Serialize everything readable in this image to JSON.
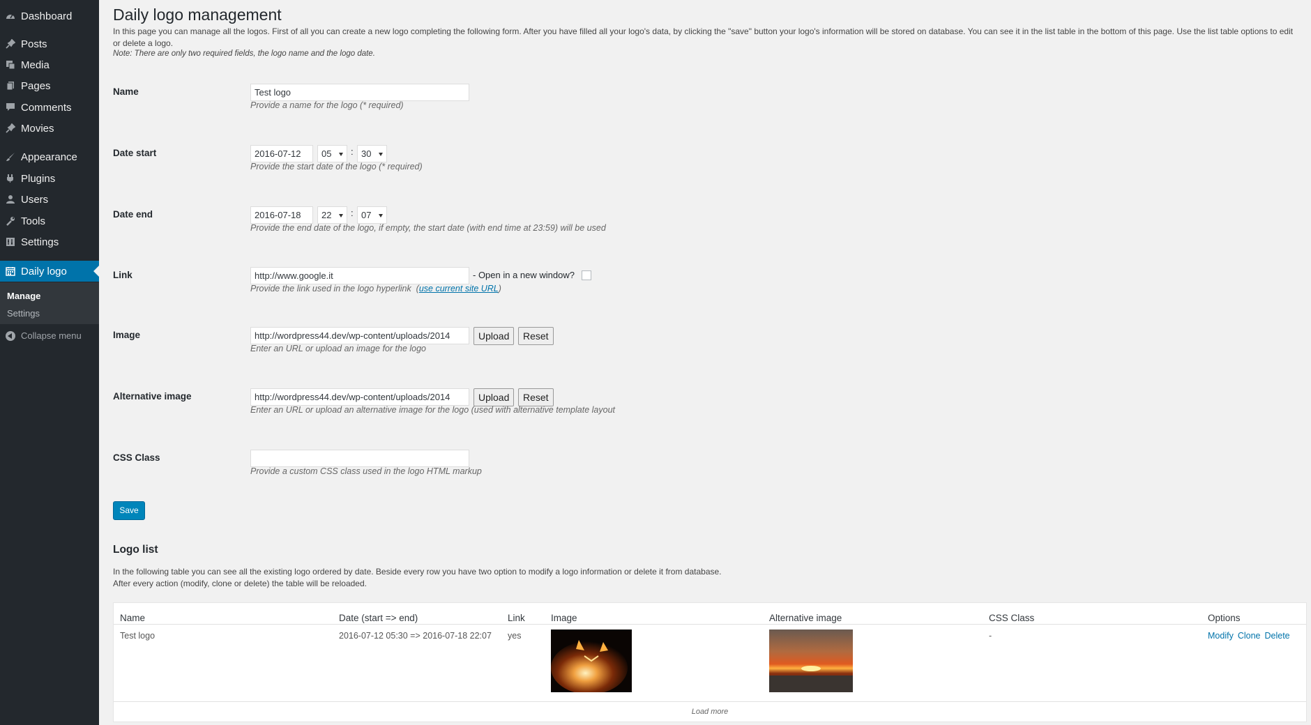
{
  "sidebar": {
    "items": [
      {
        "label": "Dashboard",
        "icon": "dashboard-icon"
      },
      {
        "label": "Posts",
        "icon": "pin-icon"
      },
      {
        "label": "Media",
        "icon": "media-icon"
      },
      {
        "label": "Pages",
        "icon": "pages-icon"
      },
      {
        "label": "Comments",
        "icon": "comments-icon"
      },
      {
        "label": "Movies",
        "icon": "pin-icon"
      },
      {
        "label": "Appearance",
        "icon": "brush-icon"
      },
      {
        "label": "Plugins",
        "icon": "plugin-icon"
      },
      {
        "label": "Users",
        "icon": "users-icon"
      },
      {
        "label": "Tools",
        "icon": "wrench-icon"
      },
      {
        "label": "Settings",
        "icon": "settings-icon"
      },
      {
        "label": "Daily logo",
        "icon": "calendar-icon"
      }
    ],
    "submenu": [
      "Manage",
      "Settings"
    ],
    "collapse_label": "Collapse menu"
  },
  "page": {
    "title": "Daily logo management",
    "intro": "In this page you can manage all the logos. First of all you can create a new logo completing the following form. After you have filled all your logo's data, by clicking the \"save\" button your logo's information will be stored on database. You can see it in the list table in the bottom of this page. Use the list table options to edit or delete a logo.",
    "note": "Note: There are only two required fields, the logo name and the logo date."
  },
  "form": {
    "name": {
      "label": "Name",
      "value": "Test logo",
      "desc": "Provide a name for the logo (* required)"
    },
    "date_start": {
      "label": "Date start",
      "date": "2016-07-12",
      "hour": "05",
      "minute": "30",
      "desc": "Provide the start date of the logo (* required)"
    },
    "date_end": {
      "label": "Date end",
      "date": "2016-07-18",
      "hour": "22",
      "minute": "07",
      "desc": "Provide the end date of the logo, if empty, the start date (with end time at 23:59) will be used"
    },
    "link": {
      "label": "Link",
      "value": "http://www.google.it",
      "new_window_label": "- Open in a new window?",
      "desc": "Provide the link used in the logo hyperlink",
      "current_url_link": "use current site URL"
    },
    "image": {
      "label": "Image",
      "value": "http://wordpress44.dev/wp-content/uploads/2014",
      "upload": "Upload",
      "reset": "Reset",
      "desc": "Enter an URL or upload an image for the logo"
    },
    "alt_image": {
      "label": "Alternative image",
      "value": "http://wordpress44.dev/wp-content/uploads/2014",
      "upload": "Upload",
      "reset": "Reset",
      "desc": "Enter an URL or upload an alternative image for the logo (used with alternative template layout"
    },
    "css_class": {
      "label": "CSS Class",
      "value": "",
      "desc": "Provide a custom CSS class used in the logo HTML markup"
    },
    "colon": ":",
    "save_label": "Save"
  },
  "list": {
    "title": "Logo list",
    "desc1": "In the following table you can see all the existing logo ordered by date. Beside every row you have two option to modify a logo information or delete it from database.",
    "desc2": "After every action (modify, clone or delete) the table will be reloaded.",
    "columns": [
      "Name",
      "Date (start => end)",
      "Link",
      "Image",
      "Alternative image",
      "CSS Class",
      "Options"
    ],
    "rows": [
      {
        "name": "Test logo",
        "date": "2016-07-12 05:30 => 2016-07-18 22:07",
        "link": "yes",
        "css": "-",
        "options": [
          "Modify",
          "Clone",
          "Delete"
        ]
      }
    ],
    "load_more": "Load more"
  },
  "colors": {
    "sidebar_bg": "#23282d",
    "accent": "#0073aa",
    "save_button": "#0085ba"
  }
}
